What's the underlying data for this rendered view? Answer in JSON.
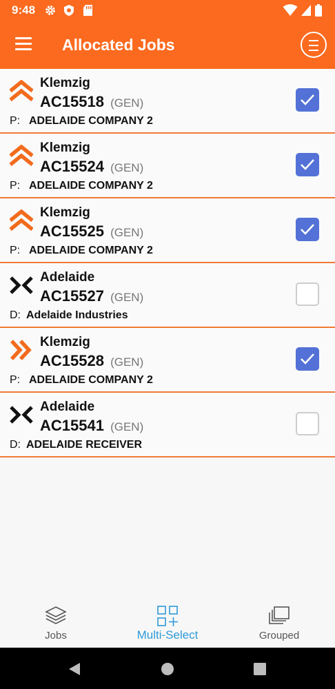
{
  "status_bar": {
    "time": "9:48"
  },
  "app_bar": {
    "title": "Allocated Jobs"
  },
  "jobs": [
    {
      "location": "Klemzig",
      "number": "AC15518",
      "type": "(GEN)",
      "party_code": "P:",
      "company": "ADELAIDE COMPANY 2",
      "icon": "double-chevron-up-icon",
      "checked": true
    },
    {
      "location": "Klemzig",
      "number": "AC15524",
      "type": "(GEN)",
      "party_code": "P:",
      "company": "ADELAIDE COMPANY 2",
      "icon": "double-chevron-up-icon",
      "checked": true
    },
    {
      "location": "Klemzig",
      "number": "AC15525",
      "type": "(GEN)",
      "party_code": "P:",
      "company": "ADELAIDE COMPANY 2",
      "icon": "double-chevron-up-icon",
      "checked": true
    },
    {
      "location": "Adelaide",
      "number": "AC15527",
      "type": "(GEN)",
      "party_code": "D:",
      "company": "Adelaide Industries",
      "icon": "converge-arrows-icon",
      "checked": false
    },
    {
      "location": "Klemzig",
      "number": "AC15528",
      "type": "(GEN)",
      "party_code": "P:",
      "company": "ADELAIDE COMPANY 2",
      "icon": "double-chevron-right-icon",
      "checked": true
    },
    {
      "location": "Adelaide",
      "number": "AC15541",
      "type": "(GEN)",
      "party_code": "D:",
      "company": "ADELAIDE RECEIVER",
      "icon": "converge-arrows-icon",
      "checked": false
    }
  ],
  "bottom_nav": {
    "items": [
      {
        "label": "Jobs",
        "icon": "layers-icon",
        "active": false
      },
      {
        "label": "Multi-Select",
        "icon": "multi-select-icon",
        "active": true
      },
      {
        "label": "Grouped",
        "icon": "stacked-pages-icon",
        "active": false
      }
    ]
  },
  "colors": {
    "brand": "#fb6a1e",
    "accent_check": "#5371d6",
    "active_nav": "#2d9ad8",
    "divider": "#f07a35"
  }
}
